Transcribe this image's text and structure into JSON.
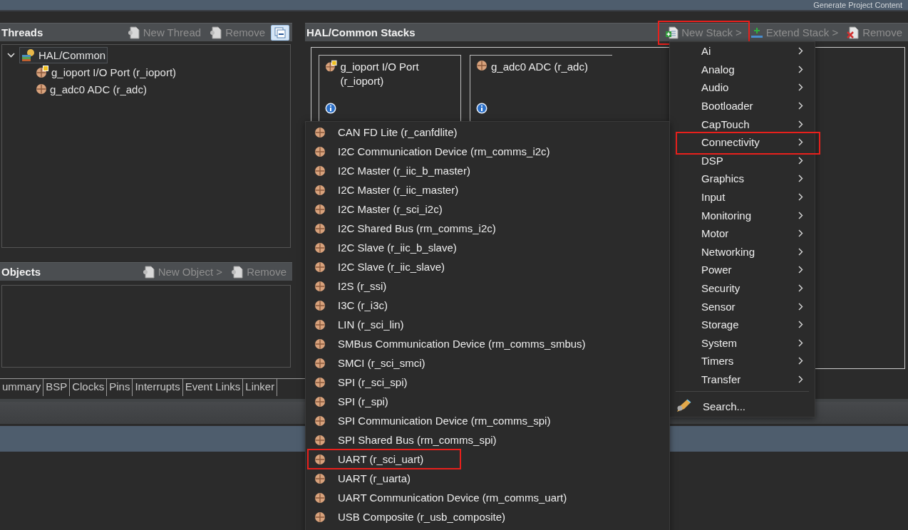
{
  "top_bar": {
    "action": "Generate Project Content"
  },
  "threads_panel": {
    "title": "Threads",
    "actions": [
      {
        "label": "New Thread",
        "disabled": true
      },
      {
        "label": "Remove",
        "disabled": true
      }
    ],
    "tree": [
      {
        "label": "HAL/Common",
        "expanded": true,
        "selected": true,
        "children": [
          {
            "label": "g_ioport I/O Port (r_ioport)",
            "selected": false,
            "kind": "port"
          },
          {
            "label": "g_adc0 ADC (r_adc)",
            "selected": false,
            "kind": "module"
          }
        ]
      }
    ]
  },
  "objects_panel": {
    "title": "Objects",
    "actions": [
      {
        "label": "New Object >",
        "disabled": true
      },
      {
        "label": "Remove",
        "disabled": true
      }
    ]
  },
  "editor_tabs": [
    {
      "label": "ummary"
    },
    {
      "label": "BSP"
    },
    {
      "label": "Clocks"
    },
    {
      "label": "Pins"
    },
    {
      "label": "Interrupts"
    },
    {
      "label": "Event Links"
    },
    {
      "label": "Linker"
    }
  ],
  "stacks_panel": {
    "title": "HAL/Common Stacks",
    "actions": [
      {
        "label": "New Stack >",
        "kind": "add",
        "disabled": true,
        "highlighted": true
      },
      {
        "label": "Extend Stack >",
        "kind": "extend",
        "disabled": true,
        "highlighted": false
      },
      {
        "label": "Remove",
        "kind": "remove",
        "disabled": true,
        "highlighted": false
      }
    ],
    "modules": [
      {
        "name": "g_ioport I/O Port (r_ioport)",
        "kind": "port"
      },
      {
        "name": "g_adc0 ADC (r_adc)",
        "kind": "module"
      }
    ]
  },
  "stack_menu": {
    "items": [
      {
        "label": "Ai",
        "highlighted": false
      },
      {
        "label": "Analog",
        "highlighted": false
      },
      {
        "label": "Audio",
        "highlighted": false
      },
      {
        "label": "Bootloader",
        "highlighted": false
      },
      {
        "label": "CapTouch",
        "highlighted": false
      },
      {
        "label": "Connectivity",
        "highlighted": true
      },
      {
        "label": "DSP",
        "highlighted": false
      },
      {
        "label": "Graphics",
        "highlighted": false
      },
      {
        "label": "Input",
        "highlighted": false
      },
      {
        "label": "Monitoring",
        "highlighted": false
      },
      {
        "label": "Motor",
        "highlighted": false
      },
      {
        "label": "Networking",
        "highlighted": false
      },
      {
        "label": "Power",
        "highlighted": false
      },
      {
        "label": "Security",
        "highlighted": false
      },
      {
        "label": "Sensor",
        "highlighted": false
      },
      {
        "label": "Storage",
        "highlighted": false
      },
      {
        "label": "System",
        "highlighted": false
      },
      {
        "label": "Timers",
        "highlighted": false
      },
      {
        "label": "Transfer",
        "highlighted": false
      }
    ],
    "search": "Search..."
  },
  "connectivity_menu": {
    "items": [
      {
        "label": "CAN FD Lite (r_canfdlite)",
        "highlighted": false
      },
      {
        "label": "I2C Communication Device (rm_comms_i2c)",
        "highlighted": false
      },
      {
        "label": "I2C Master (r_iic_b_master)",
        "highlighted": false
      },
      {
        "label": "I2C Master (r_iic_master)",
        "highlighted": false
      },
      {
        "label": "I2C Master (r_sci_i2c)",
        "highlighted": false
      },
      {
        "label": "I2C Shared Bus (rm_comms_i2c)",
        "highlighted": false
      },
      {
        "label": "I2C Slave (r_iic_b_slave)",
        "highlighted": false
      },
      {
        "label": "I2C Slave (r_iic_slave)",
        "highlighted": false
      },
      {
        "label": "I2S (r_ssi)",
        "highlighted": false
      },
      {
        "label": "I3C (r_i3c)",
        "highlighted": false
      },
      {
        "label": "LIN (r_sci_lin)",
        "highlighted": false
      },
      {
        "label": "SMBus Communication Device (rm_comms_smbus)",
        "highlighted": false
      },
      {
        "label": "SMCI (r_sci_smci)",
        "highlighted": false
      },
      {
        "label": "SPI (r_sci_spi)",
        "highlighted": false
      },
      {
        "label": "SPI (r_spi)",
        "highlighted": false
      },
      {
        "label": "SPI Communication Device (rm_comms_spi)",
        "highlighted": false
      },
      {
        "label": "SPI Shared Bus (rm_comms_spi)",
        "highlighted": false
      },
      {
        "label": "UART (r_sci_uart)",
        "highlighted": true
      },
      {
        "label": "UART (r_uarta)",
        "highlighted": false
      },
      {
        "label": "UART Communication Device (rm_comms_uart)",
        "highlighted": false
      },
      {
        "label": "USB Composite (r_usb_composite)",
        "highlighted": false
      }
    ]
  }
}
